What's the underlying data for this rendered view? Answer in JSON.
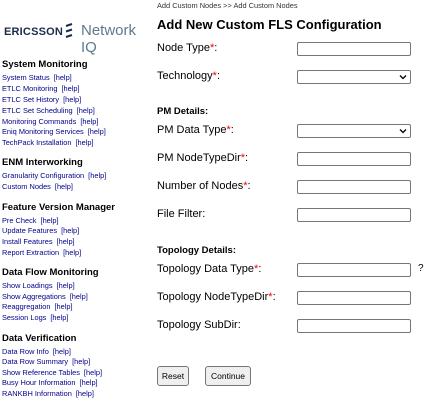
{
  "breadcrumb": {
    "first": "Add Custom Nodes",
    "sep": ">>",
    "second": "Add Custom Nodes"
  },
  "logo": {
    "brand": "ERICSSON",
    "product": "Network IQ"
  },
  "sidebar": {
    "sections": [
      {
        "title": "System Monitoring",
        "items": [
          {
            "label": "System Status",
            "help": "[help]"
          },
          {
            "label": "ETLC Monitoring",
            "help": "[help]"
          },
          {
            "label": "ETLC Set History",
            "help": "[help]"
          },
          {
            "label": "ETLC Set Scheduling",
            "help": "[help]"
          },
          {
            "label": "Monitoring Commands",
            "help": "[help]"
          },
          {
            "label": "Eniq Monitoring Services",
            "help": "[help]"
          },
          {
            "label": "TechPack Installation",
            "help": "[help]"
          }
        ]
      },
      {
        "title": "ENM Interworking",
        "items": [
          {
            "label": "Granularity Configuration",
            "help": "[help]"
          },
          {
            "label": "Custom Nodes",
            "help": "[help]"
          }
        ]
      },
      {
        "title": "Feature Version Manager",
        "items": [
          {
            "label": "Pre Check",
            "help": "[help]"
          },
          {
            "label": "Update Features",
            "help": "[help]"
          },
          {
            "label": "Install Features",
            "help": "[help]"
          },
          {
            "label": "Report Extraction",
            "help": "[help]"
          }
        ]
      },
      {
        "title": "Data Flow Monitoring",
        "items": [
          {
            "label": "Show Loadings",
            "help": "[help]"
          },
          {
            "label": "Show Aggregations",
            "help": "[help]"
          },
          {
            "label": "Reaggregation",
            "help": "[help]"
          },
          {
            "label": "Session Logs",
            "help": "[help]"
          }
        ]
      },
      {
        "title": "Data Verification",
        "items": [
          {
            "label": "Data Row Info",
            "help": "[help]"
          },
          {
            "label": "Data Row Summary",
            "help": "[help]"
          },
          {
            "label": "Show Reference Tables",
            "help": "[help]"
          },
          {
            "label": "Busy Hour Information",
            "help": "[help]"
          },
          {
            "label": "RANKBH Information",
            "help": "[help]"
          }
        ]
      }
    ]
  },
  "form": {
    "title": "Add New Custom FLS Configuration",
    "node_type": {
      "label": "Node Type",
      "req": "*",
      "colon": ":",
      "value": ""
    },
    "technology": {
      "label": "Technology",
      "req": "*",
      "colon": ":",
      "value": ""
    },
    "pm_details": "PM Details:",
    "pm_data_type": {
      "label": "PM Data Type",
      "req": "*",
      "colon": ":",
      "value": ""
    },
    "pm_nodetypedir": {
      "label": "PM NodeTypeDir",
      "req": "*",
      "colon": ":",
      "value": ""
    },
    "num_nodes": {
      "label": "Number of Nodes",
      "req": "*",
      "colon": ":",
      "value": ""
    },
    "file_filter": {
      "label": "File Filter:",
      "value": ""
    },
    "topology_details": "Topology Details:",
    "topo_data_type": {
      "label": "Topology Data Type",
      "req": "*",
      "colon": ":",
      "value": "",
      "qmark": "?"
    },
    "topo_nodetypedir": {
      "label": "Topology NodeTypeDir",
      "req": "*",
      "colon": ":",
      "value": ""
    },
    "topo_subdir": {
      "label": "Topology SubDir:",
      "value": ""
    },
    "reset_label": "Reset",
    "continue_label": "Continue"
  }
}
